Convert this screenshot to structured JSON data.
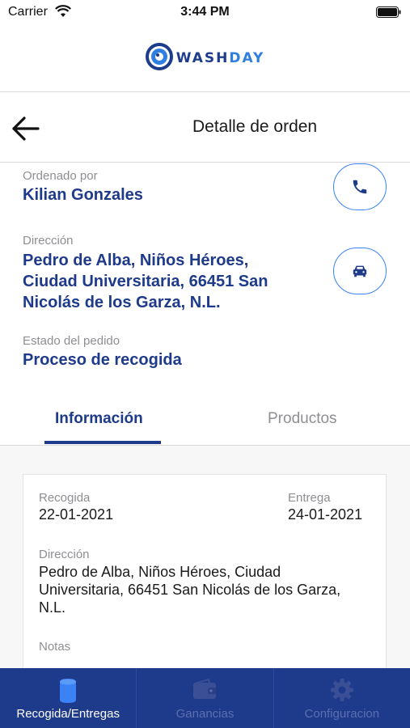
{
  "status_bar": {
    "carrier": "Carrier",
    "time": "3:44 PM"
  },
  "brand": {
    "name_part1": "WASH",
    "name_part2": "DAY"
  },
  "header": {
    "title": "Detalle de orden"
  },
  "order": {
    "ordered_by_label": "Ordenado por",
    "ordered_by_value": "Kilian Gonzales",
    "address_label": "Dirección",
    "address_line1": "Pedro de Alba, Niños Héroes,",
    "address_line2": "Ciudad Universitaria, 66451 San",
    "address_line3": "Nicolás de los Garza, N.L.",
    "status_label": "Estado del pedido",
    "status_value": "Proceso de recogida"
  },
  "tabs": {
    "info": "Información",
    "products": "Productos"
  },
  "info_card": {
    "pickup_label": "Recogida",
    "pickup_value": "22-01-2021",
    "delivery_label": "Entrega",
    "delivery_value": "24-01-2021",
    "address_label": "Dirección",
    "address_line1": "Pedro de Alba, Niños Héroes, Ciudad",
    "address_line2": "Universitaria, 66451 San Nicolás de los Garza,",
    "address_line3": "N.L.",
    "notes_label": "Notas"
  },
  "tabbar": {
    "items": [
      {
        "label": "Recogida/Entregas",
        "icon": "cylinder-icon",
        "active": true
      },
      {
        "label": "Ganancias",
        "icon": "wallet-icon",
        "active": false
      },
      {
        "label": "Configuracion",
        "icon": "gear-icon",
        "active": false
      }
    ]
  },
  "colors": {
    "primary": "#1e3a8a",
    "accent": "#3b82f6",
    "muted": "#8e8e93"
  }
}
